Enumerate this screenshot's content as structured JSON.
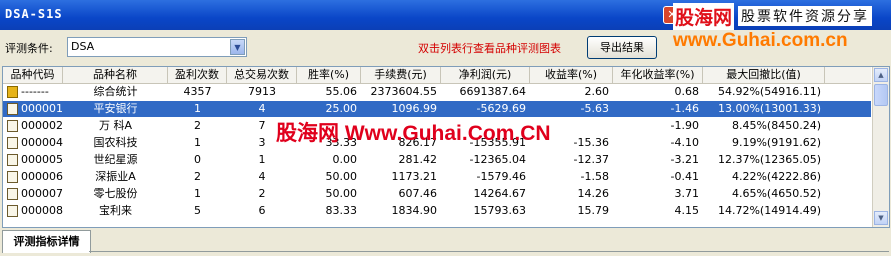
{
  "window": {
    "title": "DSA-S1S"
  },
  "brand": {
    "name_cn": "股海网",
    "tagline": "股票软件资源分享",
    "url": "www.Guhai.com.cn"
  },
  "toolbar": {
    "condition_label": "评测条件:",
    "condition_value": "DSA",
    "hint": "双击列表行查看品种评测图表",
    "export_label": "导出结果"
  },
  "table": {
    "columns": [
      "品种代码",
      "品种名称",
      "盈利次数",
      "总交易次数",
      "胜率(%)",
      "手续费(元)",
      "净利润(元)",
      "收益率(%)",
      "年化收益率(%)",
      "最大回撤比(值)"
    ],
    "rows": [
      {
        "code": "-------",
        "name": "综合统计",
        "wins": "4357",
        "trades": "7913",
        "winrate": "55.06",
        "fee": "2373604.55",
        "profit": "6691387.64",
        "ret": "2.60",
        "annual": "0.68",
        "drawdown": "54.92%(54916.11)"
      },
      {
        "code": "000001",
        "name": "平安银行",
        "wins": "1",
        "trades": "4",
        "winrate": "25.00",
        "fee": "1096.99",
        "profit": "-5629.69",
        "ret": "-5.63",
        "annual": "-1.46",
        "drawdown": "13.00%(13001.33)"
      },
      {
        "code": "000002",
        "name": "万  科A",
        "wins": "2",
        "trades": "7",
        "winrate": "",
        "fee": "",
        "profit": "",
        "ret": "",
        "annual": "-1.90",
        "drawdown": "8.45%(8450.24)"
      },
      {
        "code": "000004",
        "name": "国农科技",
        "wins": "1",
        "trades": "3",
        "winrate": "33.33",
        "fee": "826.17",
        "profit": "-15355.91",
        "ret": "-15.36",
        "annual": "-4.10",
        "drawdown": "9.19%(9191.62)"
      },
      {
        "code": "000005",
        "name": "世纪星源",
        "wins": "0",
        "trades": "1",
        "winrate": "0.00",
        "fee": "281.42",
        "profit": "-12365.04",
        "ret": "-12.37",
        "annual": "-3.21",
        "drawdown": "12.37%(12365.05)"
      },
      {
        "code": "000006",
        "name": "深振业A",
        "wins": "2",
        "trades": "4",
        "winrate": "50.00",
        "fee": "1173.21",
        "profit": "-1579.46",
        "ret": "-1.58",
        "annual": "-0.41",
        "drawdown": "4.22%(4222.86)"
      },
      {
        "code": "000007",
        "name": "零七股份",
        "wins": "1",
        "trades": "2",
        "winrate": "50.00",
        "fee": "607.46",
        "profit": "14264.67",
        "ret": "14.26",
        "annual": "3.71",
        "drawdown": "4.65%(4650.52)"
      },
      {
        "code": "000008",
        "name": "宝利来",
        "wins": "5",
        "trades": "6",
        "winrate": "83.33",
        "fee": "1834.90",
        "profit": "15793.63",
        "ret": "15.79",
        "annual": "4.15",
        "drawdown": "14.72%(14914.49)"
      }
    ],
    "selected_row": 1
  },
  "watermark": "股海网 Www.Guhai.Com.CN",
  "tabs": {
    "detail_label": "评测指标详情"
  },
  "icons": {
    "close": "close-icon",
    "dropdown": "chevron-down-icon",
    "row": "document-icon",
    "summary": "summary-folder-icon"
  },
  "colors": {
    "titlebar": "#0a46c8",
    "selection": "#316ac5",
    "hint": "#d40000",
    "brand_red": "#e0101a",
    "brand_orange": "#ff7a00"
  }
}
